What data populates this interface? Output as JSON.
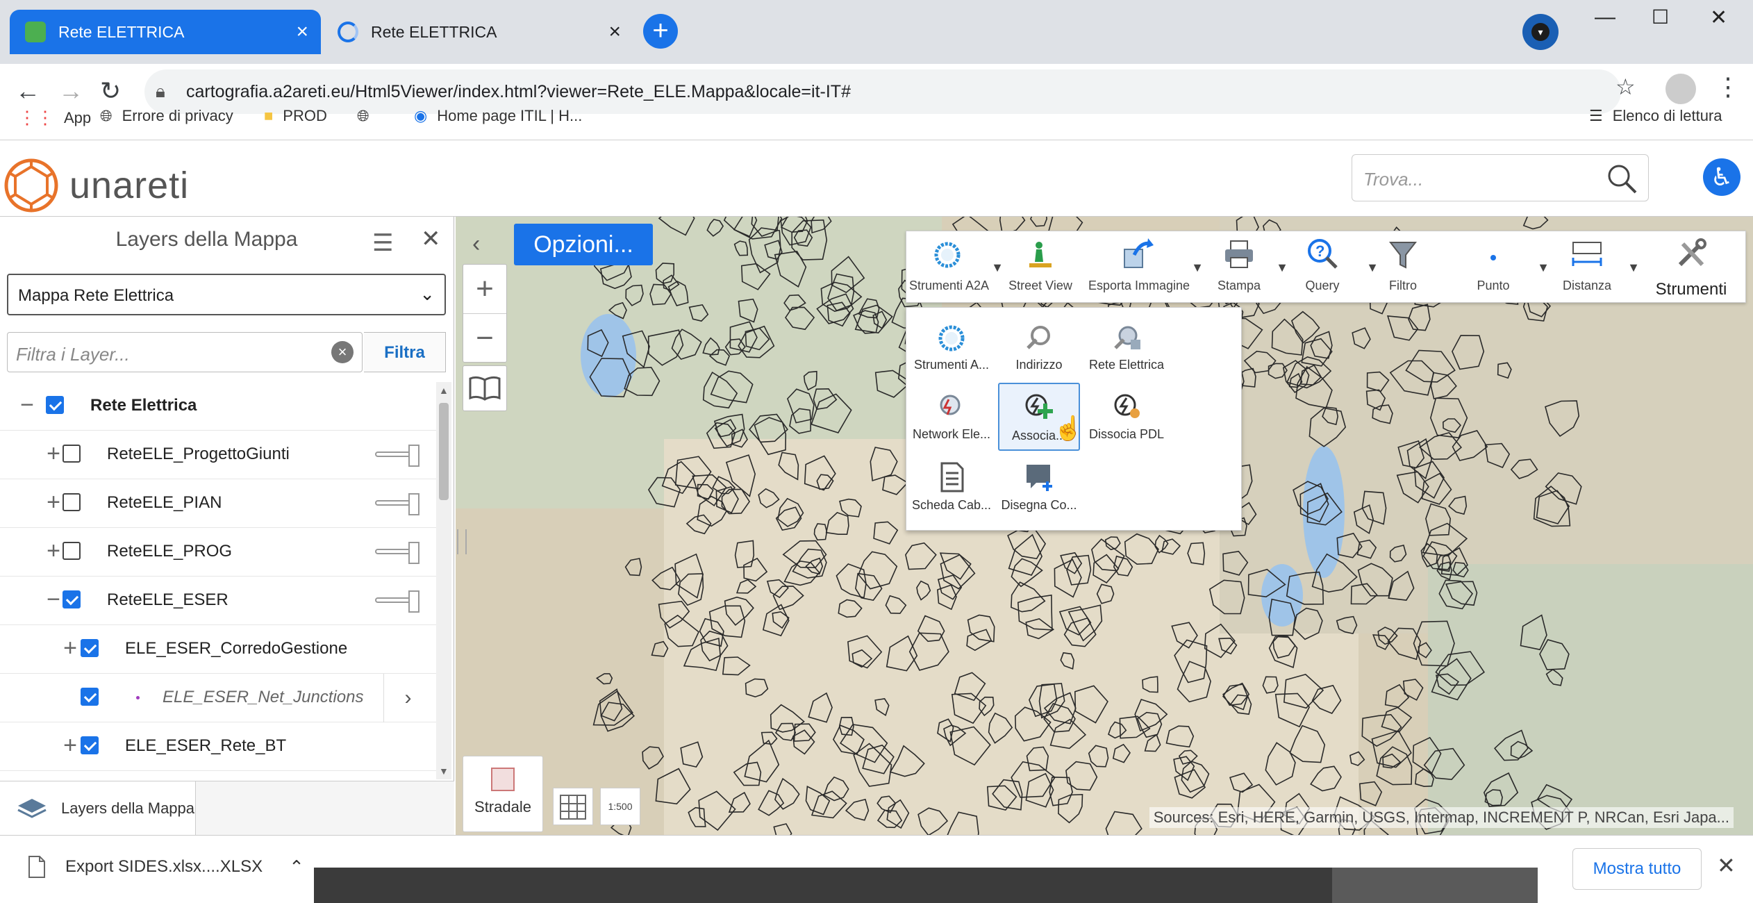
{
  "browser": {
    "tabs": [
      {
        "title": "Rete ELETTRICA",
        "active": true
      },
      {
        "title": "Rete ELETTRICA",
        "active": false
      }
    ],
    "url": "cartografia.a2areti.eu/Html5Viewer/index.html?viewer=Rete_ELE.Mappa&locale=it-IT#",
    "bookmarks": [
      "App",
      "Errore di privacy",
      "PROD",
      "Home page ITIL | H..."
    ],
    "reading_list": "Elenco di lettura"
  },
  "header": {
    "logo_text": "unareti",
    "search_placeholder": "Trova..."
  },
  "panel": {
    "title": "Layers della Mappa",
    "map_select": "Mappa Rete Elettrica",
    "filter_placeholder": "Filtra i Layer...",
    "filter_button": "Filtra",
    "layers": [
      {
        "label": "Rete Elettrica",
        "toggle": "−",
        "checked": true,
        "slider": false,
        "bold": true
      },
      {
        "label": "ReteELE_ProgettoGiunti",
        "toggle": "+",
        "checked": false,
        "slider": true
      },
      {
        "label": "ReteELE_PIAN",
        "toggle": "+",
        "checked": false,
        "slider": true
      },
      {
        "label": "ReteELE_PROG",
        "toggle": "+",
        "checked": false,
        "slider": true
      },
      {
        "label": "ReteELE_ESER",
        "toggle": "−",
        "checked": true,
        "slider": true
      },
      {
        "label": "ELE_ESER_CorredoGestione",
        "toggle": "+",
        "checked": true,
        "slider": false
      },
      {
        "label": "ELE_ESER_Net_Junctions",
        "toggle": "",
        "checked": true,
        "slider": false,
        "italic": true
      },
      {
        "label": "ELE_ESER_Rete_BT",
        "toggle": "+",
        "checked": true,
        "slider": false
      }
    ],
    "bottom_tab": "Layers della Mappa"
  },
  "map": {
    "options_button": "Opzioni...",
    "basemap_label": "Stradale",
    "scale_label": "1:500",
    "attribution": "Sources: Esri, HERE, Garmin, USGS, Intermap, INCREMENT P, NRCan, Esri Japa..."
  },
  "ribbon": {
    "items": [
      {
        "label": "Strumenti A2A",
        "icon": "a2a-tools-icon",
        "dropdown": true
      },
      {
        "label": "Street View",
        "icon": "street-view-icon",
        "dropdown": false
      },
      {
        "label": "Esporta Immagine",
        "icon": "export-image-icon",
        "dropdown": true
      },
      {
        "label": "Stampa",
        "icon": "print-icon",
        "dropdown": true
      },
      {
        "label": "Query",
        "icon": "query-icon",
        "dropdown": true
      },
      {
        "label": "Filtro",
        "icon": "filter-icon",
        "dropdown": false
      },
      {
        "label": "Punto",
        "icon": "point-icon",
        "dropdown": true
      },
      {
        "label": "Distanza",
        "icon": "distance-icon",
        "dropdown": true
      },
      {
        "label": "Strumenti",
        "icon": "tools-icon",
        "dropdown": false
      }
    ],
    "dropdown_items": [
      {
        "label": "Strumenti A...",
        "icon": "a2a-tools-icon"
      },
      {
        "label": "Indirizzo",
        "icon": "address-icon"
      },
      {
        "label": "Rete Elettrica",
        "icon": "electric-network-icon"
      },
      {
        "label": "Network Ele...",
        "icon": "network-electric-icon"
      },
      {
        "label": "Associa...",
        "icon": "associate-icon",
        "selected": true
      },
      {
        "label": "Dissocia PDL",
        "icon": "dissociate-icon"
      },
      {
        "label": "Scheda Cab...",
        "icon": "cabin-sheet-icon"
      },
      {
        "label": "Disegna Co...",
        "icon": "draw-icon"
      }
    ]
  },
  "downloads": {
    "file": "Export SIDES.xlsx....XLSX",
    "show_all": "Mostra tutto"
  },
  "colors": {
    "accent": "#1a73e8",
    "logo_orange": "#e8732a"
  }
}
